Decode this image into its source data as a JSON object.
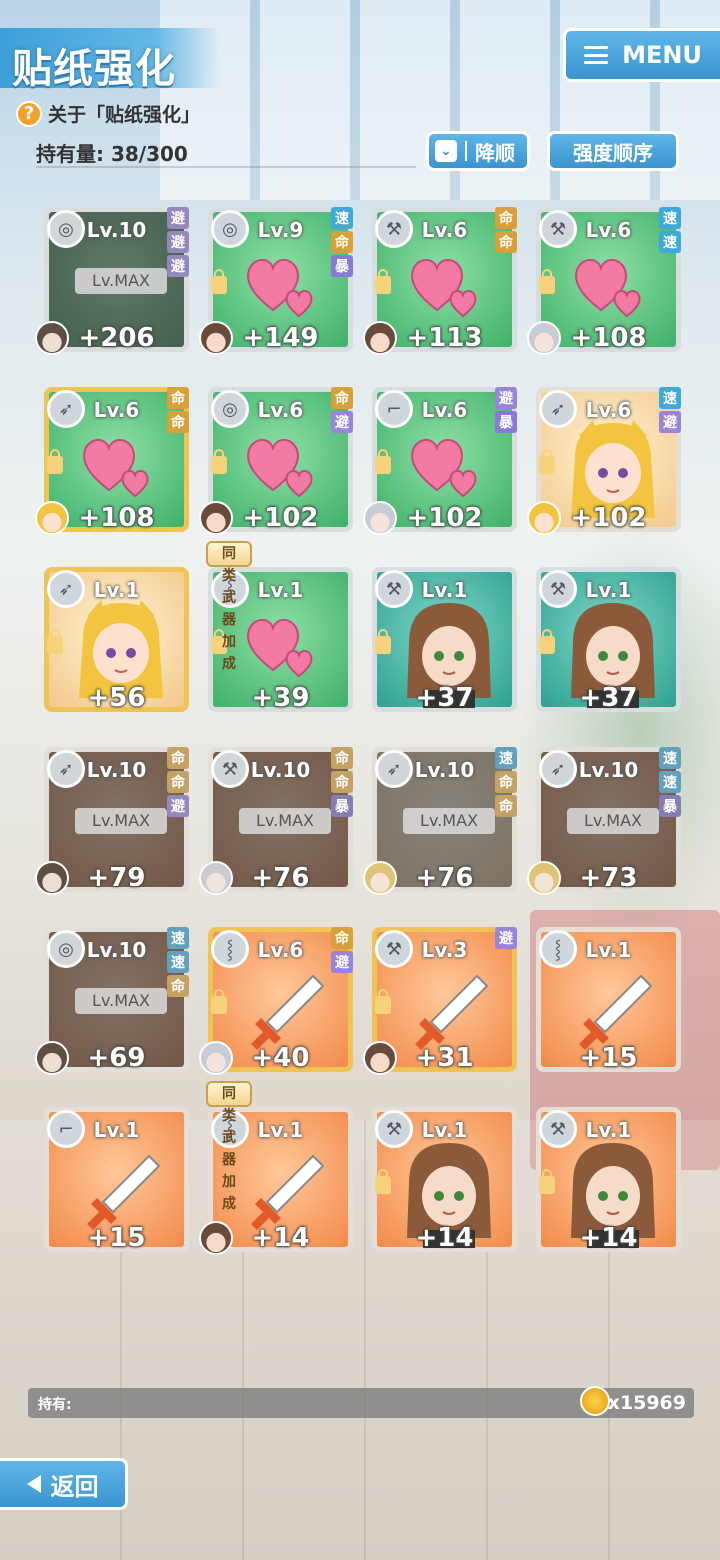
{
  "header": {
    "title": "贴纸强化",
    "help_text": "关于「贴纸强化」",
    "count_label": "持有量: 38/300",
    "menu_label": "MENU",
    "sort_label": "降顺",
    "order_label": "强度顺序"
  },
  "bonus_label": "同类武器加成",
  "cards": [
    {
      "level": "Lv.10",
      "value": "+206",
      "max": "Lv.MAX",
      "tags": [
        "避",
        "避",
        "避"
      ]
    },
    {
      "level": "Lv.9",
      "value": "+149",
      "tags": [
        "速",
        "命",
        "暴"
      ]
    },
    {
      "level": "Lv.6",
      "value": "+113",
      "tags": [
        "命",
        "命"
      ]
    },
    {
      "level": "Lv.6",
      "value": "+108",
      "tags": [
        "速",
        "速"
      ]
    },
    {
      "level": "Lv.6",
      "value": "+108",
      "tags": [
        "命",
        "命"
      ]
    },
    {
      "level": "Lv.6",
      "value": "+102",
      "tags": [
        "命",
        "避"
      ]
    },
    {
      "level": "Lv.6",
      "value": "+102",
      "tags": [
        "避",
        "暴"
      ]
    },
    {
      "level": "Lv.6",
      "value": "+102",
      "tags": [
        "速",
        "避"
      ]
    },
    {
      "level": "Lv.1",
      "value": "+56",
      "tags": []
    },
    {
      "level": "Lv.1",
      "value": "+39",
      "tags": []
    },
    {
      "level": "Lv.1",
      "value": "+37",
      "tags": []
    },
    {
      "level": "Lv.1",
      "value": "+37",
      "tags": []
    },
    {
      "level": "Lv.10",
      "value": "+79",
      "max": "Lv.MAX",
      "tags": [
        "命",
        "命",
        "避"
      ]
    },
    {
      "level": "Lv.10",
      "value": "+76",
      "max": "Lv.MAX",
      "tags": [
        "命",
        "命",
        "暴"
      ]
    },
    {
      "level": "Lv.10",
      "value": "+76",
      "max": "Lv.MAX",
      "tags": [
        "速",
        "命",
        "命"
      ]
    },
    {
      "level": "Lv.10",
      "value": "+73",
      "max": "Lv.MAX",
      "tags": [
        "速",
        "速",
        "暴"
      ]
    },
    {
      "level": "Lv.10",
      "value": "+69",
      "max": "Lv.MAX",
      "tags": [
        "速",
        "速",
        "命"
      ]
    },
    {
      "level": "Lv.6",
      "value": "+40",
      "tags": [
        "命",
        "避"
      ]
    },
    {
      "level": "Lv.3",
      "value": "+31",
      "tags": [
        "避"
      ]
    },
    {
      "level": "Lv.1",
      "value": "+15",
      "tags": []
    },
    {
      "level": "Lv.1",
      "value": "+15",
      "tags": []
    },
    {
      "level": "Lv.1",
      "value": "+14",
      "tags": []
    },
    {
      "level": "Lv.1",
      "value": "+14",
      "tags": []
    },
    {
      "level": "Lv.1",
      "value": "+14",
      "tags": []
    }
  ],
  "footer": {
    "funds_label": "持有:",
    "funds_value": "x15969",
    "back_label": "返回"
  }
}
